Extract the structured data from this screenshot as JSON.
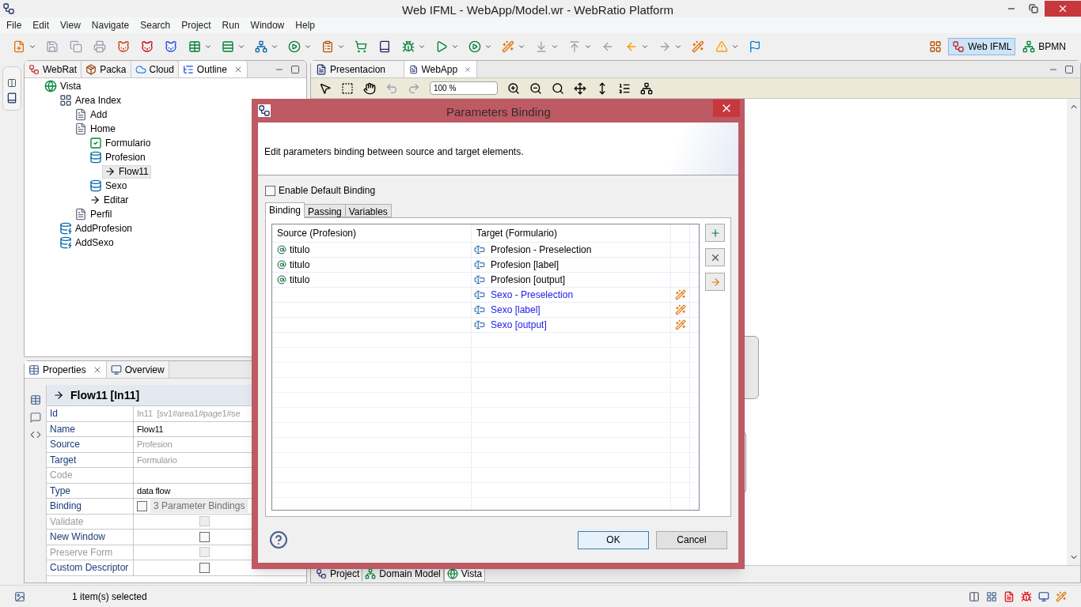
{
  "window": {
    "title": "Web IFML - WebApp/Model.wr - WebRatio Platform"
  },
  "menu": [
    "File",
    "Edit",
    "View",
    "Navigate",
    "Search",
    "Project",
    "Run",
    "Window",
    "Help"
  ],
  "perspectives": [
    {
      "label": "Web IFML",
      "selected": true
    },
    {
      "label": "BPMN",
      "selected": false
    }
  ],
  "left_tabs": [
    {
      "label": "WebRat",
      "selected": false,
      "kind": "logo"
    },
    {
      "label": "Packa",
      "selected": false,
      "kind": "package"
    },
    {
      "label": "Cloud",
      "selected": false,
      "kind": "cloud"
    },
    {
      "label": "Outline",
      "selected": true,
      "kind": "outline"
    }
  ],
  "outline": [
    {
      "label": "Vista",
      "kind": "site",
      "selected": false,
      "children": [
        {
          "label": "Area Index",
          "kind": "area",
          "selected": false,
          "children": [
            {
              "label": "Add",
              "kind": "page",
              "selected": false
            },
            {
              "label": "Home",
              "kind": "page",
              "selected": false,
              "children": [
                {
                  "label": "Formulario",
                  "kind": "form",
                  "selected": false
                },
                {
                  "label": "Profesion",
                  "kind": "list",
                  "selected": false,
                  "children": [
                    {
                      "label": "Flow11",
                      "kind": "flow",
                      "selected": true
                    }
                  ]
                },
                {
                  "label": "Sexo",
                  "kind": "list",
                  "selected": false
                },
                {
                  "label": "Editar",
                  "kind": "flow",
                  "selected": false
                }
              ]
            },
            {
              "label": "Perfil",
              "kind": "page",
              "selected": false
            }
          ]
        },
        {
          "label": "AddProfesion",
          "kind": "create",
          "selected": false
        },
        {
          "label": "AddSexo",
          "kind": "create",
          "selected": false
        }
      ]
    }
  ],
  "properties": {
    "tabs": [
      {
        "label": "Properties",
        "selected": true
      },
      {
        "label": "Overview",
        "selected": false
      }
    ],
    "header": "Flow11 [In11]",
    "rows": [
      {
        "label": "Id",
        "kind": "text",
        "value": "In11  [sv1#area1#page1#se",
        "disabled": false,
        "readonly": true
      },
      {
        "label": "Name",
        "kind": "text",
        "value": "Flow11",
        "disabled": false,
        "readonly": false
      },
      {
        "label": "Source",
        "kind": "text",
        "value": "Profesion",
        "disabled": false,
        "readonly": true
      },
      {
        "label": "Target",
        "kind": "text",
        "value": "Formulario",
        "disabled": false,
        "readonly": true
      },
      {
        "label": "Code",
        "kind": "text",
        "disabled": true
      },
      {
        "label": "Type",
        "kind": "text",
        "value": "data flow",
        "disabled": false,
        "readonly": false
      },
      {
        "label": "Binding",
        "kind": "binding",
        "value": "3 Parameter Bindings",
        "checked": false,
        "disabled": false
      },
      {
        "label": "Validate",
        "kind": "checkbox",
        "checked": false,
        "disabled": true
      },
      {
        "label": "New Window",
        "kind": "checkbox",
        "checked": false,
        "disabled": false
      },
      {
        "label": "Preserve Form",
        "kind": "checkbox",
        "checked": false,
        "disabled": true
      },
      {
        "label": "Custom Descriptor",
        "kind": "checkbox",
        "checked": false,
        "disabled": false
      }
    ]
  },
  "editor": {
    "tabs": [
      {
        "label": "Presentacion",
        "selected": false
      },
      {
        "label": "WebApp",
        "selected": true
      }
    ],
    "zoom": "100 %",
    "bottom_tabs": [
      {
        "label": "Project",
        "selected": false,
        "kind": "project"
      },
      {
        "label": "Domain Model",
        "selected": false,
        "kind": "domain"
      },
      {
        "label": "Vista",
        "selected": true,
        "kind": "site"
      }
    ]
  },
  "status_bar": {
    "text": "1 item(s) selected"
  },
  "dialog": {
    "title": "Parameters Binding",
    "description": "Edit parameters binding between source and target elements.",
    "default_binding": {
      "label": "Enable Default Binding",
      "checked": false
    },
    "tabs": [
      {
        "label": "Binding",
        "selected": true
      },
      {
        "label": "Passing",
        "selected": false
      },
      {
        "label": "Variables",
        "selected": false
      }
    ],
    "columns": [
      "Source (Profesion)",
      "Target (Formulario)"
    ],
    "rows": [
      {
        "source": "titulo",
        "target": "Profesion - Preselection",
        "unbound": false
      },
      {
        "source": "titulo",
        "target": "Profesion [label]",
        "unbound": false
      },
      {
        "source": "titulo",
        "target": "Profesion [output]",
        "unbound": false
      },
      {
        "target": "Sexo - Preselection",
        "unbound": true
      },
      {
        "target": "Sexo [label]",
        "unbound": true
      },
      {
        "target": "Sexo [output]",
        "unbound": true
      }
    ],
    "buttons": [
      {
        "label": "OK",
        "default": true
      },
      {
        "label": "Cancel",
        "default": false
      }
    ]
  }
}
